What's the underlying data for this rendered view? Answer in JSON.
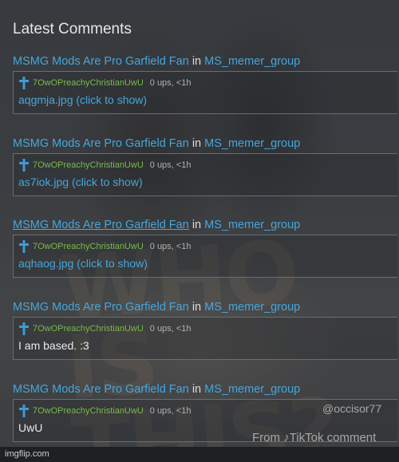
{
  "section": {
    "title": "Latest Comments"
  },
  "comments": [
    {
      "author": "MSMG Mods Are Pro Garfield Fan",
      "in_word": "in",
      "stream": "MS_memer_group",
      "user": "7OwOPreachyChristianUwU",
      "stats": "0 ups, <1h",
      "text": "aqgmja.jpg",
      "link": "(click to show)"
    },
    {
      "author": "MSMG Mods Are Pro Garfield Fan",
      "in_word": "in",
      "stream": "MS_memer_group",
      "user": "7OwOPreachyChristianUwU",
      "stats": "0 ups, <1h",
      "text": "as7iok.jpg",
      "link": "(click to show)"
    },
    {
      "author": "MSMG Mods Are Pro Garfield Fan",
      "in_word": "in",
      "stream": "MS_memer_group",
      "user": "7OwOPreachyChristianUwU",
      "stats": "0 ups, <1h",
      "text": "aqhaog.jpg",
      "link": "(click to show)"
    },
    {
      "author": "MSMG Mods Are Pro Garfield Fan",
      "in_word": "in",
      "stream": "MS_memer_group",
      "user": "7OwOPreachyChristianUwU",
      "stats": "0 ups, <1h",
      "text": "I am based. :3",
      "link": ""
    },
    {
      "author": "MSMG Mods Are Pro Garfield Fan",
      "in_word": "in",
      "stream": "MS_memer_group",
      "user": "7OwOPreachyChristianUwU",
      "stats": "0 ups, <1h",
      "text": "UwU",
      "link": ""
    }
  ],
  "background": {
    "big_text": "WHO IS THIS?"
  },
  "watermark": {
    "handle": "@occisor77",
    "tiktok": "From ♪TikTok comment"
  },
  "footer": {
    "text": "imgflip.com"
  },
  "colors": {
    "link": "#46a6dc",
    "username": "#7ab94c",
    "cross": "#3f9ad6"
  },
  "icons": {
    "user_badge": "cross-icon"
  }
}
